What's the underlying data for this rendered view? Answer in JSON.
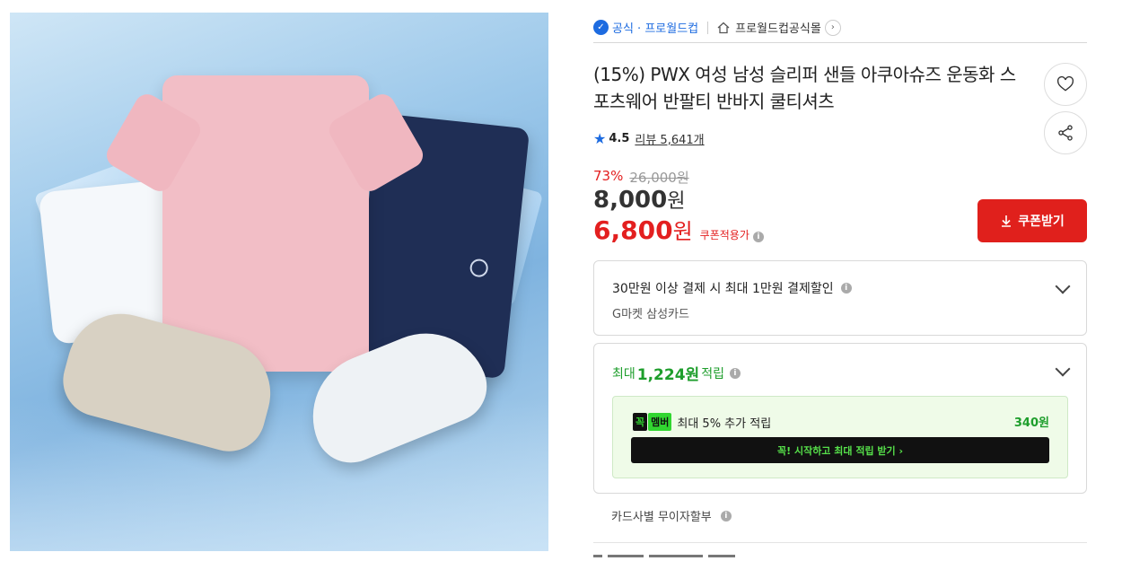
{
  "seller": {
    "official_label": "공식 · 프로월드컵",
    "store_name": "프로월드컵공식몰"
  },
  "product": {
    "title": "(15%) PWX 여성 남성 슬리퍼 샌들 아쿠아슈즈 운동화 스포츠웨어 반팔티 반바지 쿨티셔츠",
    "image_alt": "product-photo"
  },
  "rating": {
    "value": "4.5",
    "review_text": "리뷰 5,641개"
  },
  "price": {
    "discount_rate": "73%",
    "original_price": "26,000원",
    "sale_price": "8,000",
    "sale_unit": "원",
    "coupon_price": "6,800",
    "coupon_unit": "원",
    "coupon_label": "쿠폰적용가"
  },
  "buttons": {
    "coupon": "쿠폰받기",
    "coupon_icon": "download-icon",
    "wish_icon": "heart-icon",
    "share_icon": "share-icon"
  },
  "card_benefit": {
    "main": "30만원 이상 결제 시 최대 1만원 결제할인",
    "sub": "G마켓 삼성카드"
  },
  "points": {
    "prefix": "최대",
    "amount": "1,224원",
    "suffix": "적립",
    "member_logo_1": "꼭",
    "member_logo_2": "멤버",
    "member_text": "최대 5% 추가 적립",
    "member_points": "340원",
    "member_button": "꼭! 시작하고 최대 적립 받기 ›"
  },
  "installment": {
    "label": "카드사별 무이자할부"
  },
  "colors": {
    "accent_blue": "#1d6be0",
    "sale_red": "#e31f1f",
    "points_green": "#1e9e2c"
  }
}
